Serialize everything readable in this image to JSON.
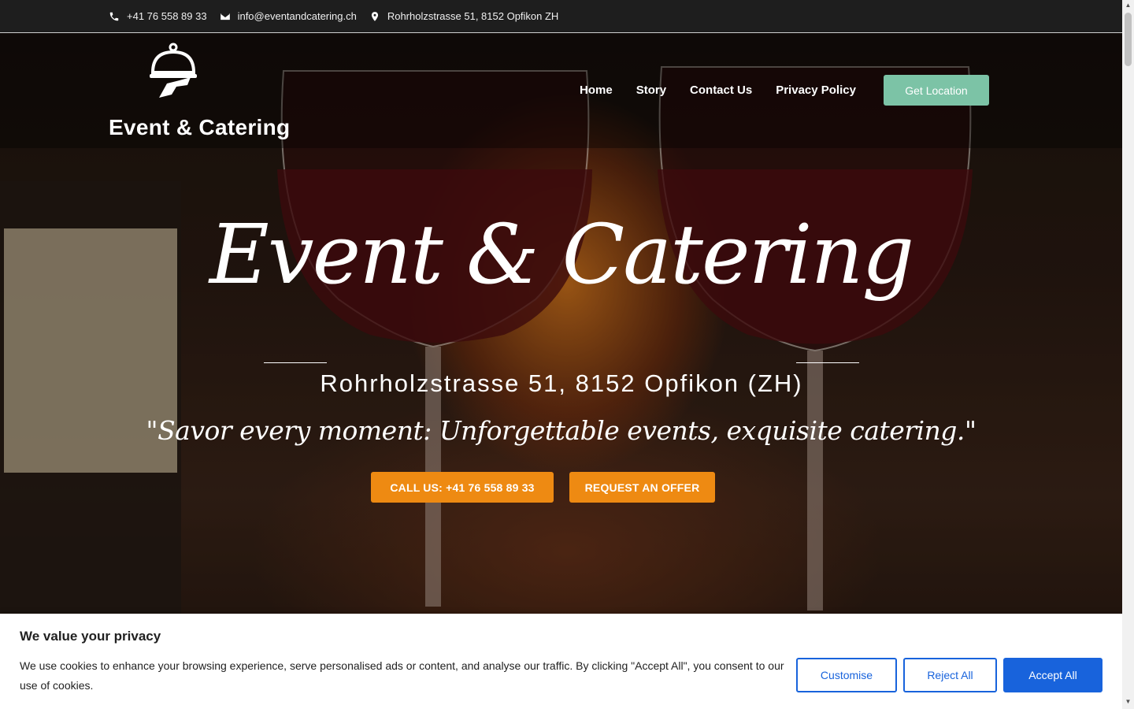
{
  "topbar": {
    "phone": "+41 76 558 89 33",
    "email": "info@eventandcatering.ch",
    "address": "Rohrholzstrasse 51, 8152 Opfikon ZH"
  },
  "header": {
    "brand": "Event & Catering",
    "nav": [
      "Home",
      "Story",
      "Contact Us",
      "Privacy Policy"
    ],
    "cta": "Get Location"
  },
  "hero": {
    "title": "Event & Catering",
    "address": "Rohrholzstrasse 51, 8152 Opfikon (ZH)",
    "tagline": "\"Savor every moment: Unforgettable events, exquisite catering.\"",
    "call_button": "CALL US: +41 76 558 89 33",
    "offer_button": "REQUEST AN OFFER"
  },
  "cookie": {
    "title": "We value your privacy",
    "text": "We use cookies to enhance your browsing experience, serve personalised ads or content, and analyse our traffic. By clicking \"Accept All\", you consent to our use of cookies.",
    "customise": "Customise",
    "reject": "Reject All",
    "accept": "Accept All"
  },
  "colors": {
    "accent_green": "#7cc3a6",
    "accent_orange": "#ee8a12",
    "cookie_blue": "#1863dc"
  }
}
